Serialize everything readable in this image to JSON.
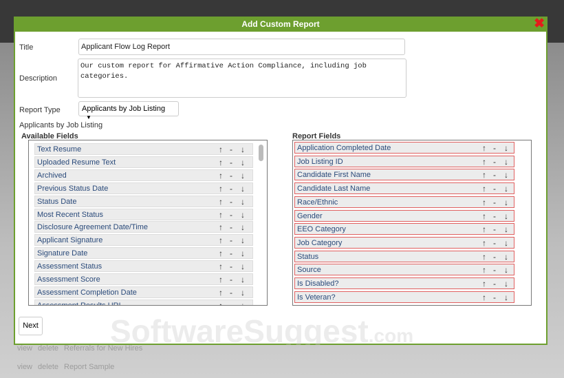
{
  "modal": {
    "title": "Add Custom Report",
    "close": "✖"
  },
  "form": {
    "title_label": "Title",
    "title_value": "Applicant Flow Log Report",
    "description_label": "Description",
    "description_value": "Our custom report for Affirmative Action Compliance, including job categories.",
    "report_type_label": "Report Type",
    "report_type_value": "Applicants by Job Listing",
    "report_type_caption": "Applicants by Job Listing"
  },
  "available": {
    "header": "Available Fields",
    "items": [
      "Text Resume",
      "Uploaded Resume Text",
      "Archived",
      "Previous Status Date",
      "Status Date",
      "Most Recent Status",
      "Disclosure Agreement Date/Time",
      "Applicant Signature",
      "Signature Date",
      "Assessment Status",
      "Assessment Score",
      "Assessment Completion Date",
      "Assessment Results URL"
    ]
  },
  "report": {
    "header": "Report Fields",
    "items": [
      "Application Completed Date",
      "Job Listing ID",
      "Candidate First Name",
      "Candidate Last Name",
      "Race/Ethnic",
      "Gender",
      "EEO Category",
      "Job Category",
      "Status",
      "Source",
      "Is Disabled?",
      "Is Veteran?"
    ]
  },
  "controls": {
    "up": "↑",
    "remove": "-",
    "down": "↓"
  },
  "next_label": "Next",
  "background_rows": [
    {
      "view": "view",
      "delete": "delete",
      "name": "Referrals for New Hires"
    },
    {
      "view": "view",
      "delete": "delete",
      "name": "Report Sample"
    }
  ],
  "watermark": "SoftwareSuggest",
  "watermark_suffix": ".com"
}
